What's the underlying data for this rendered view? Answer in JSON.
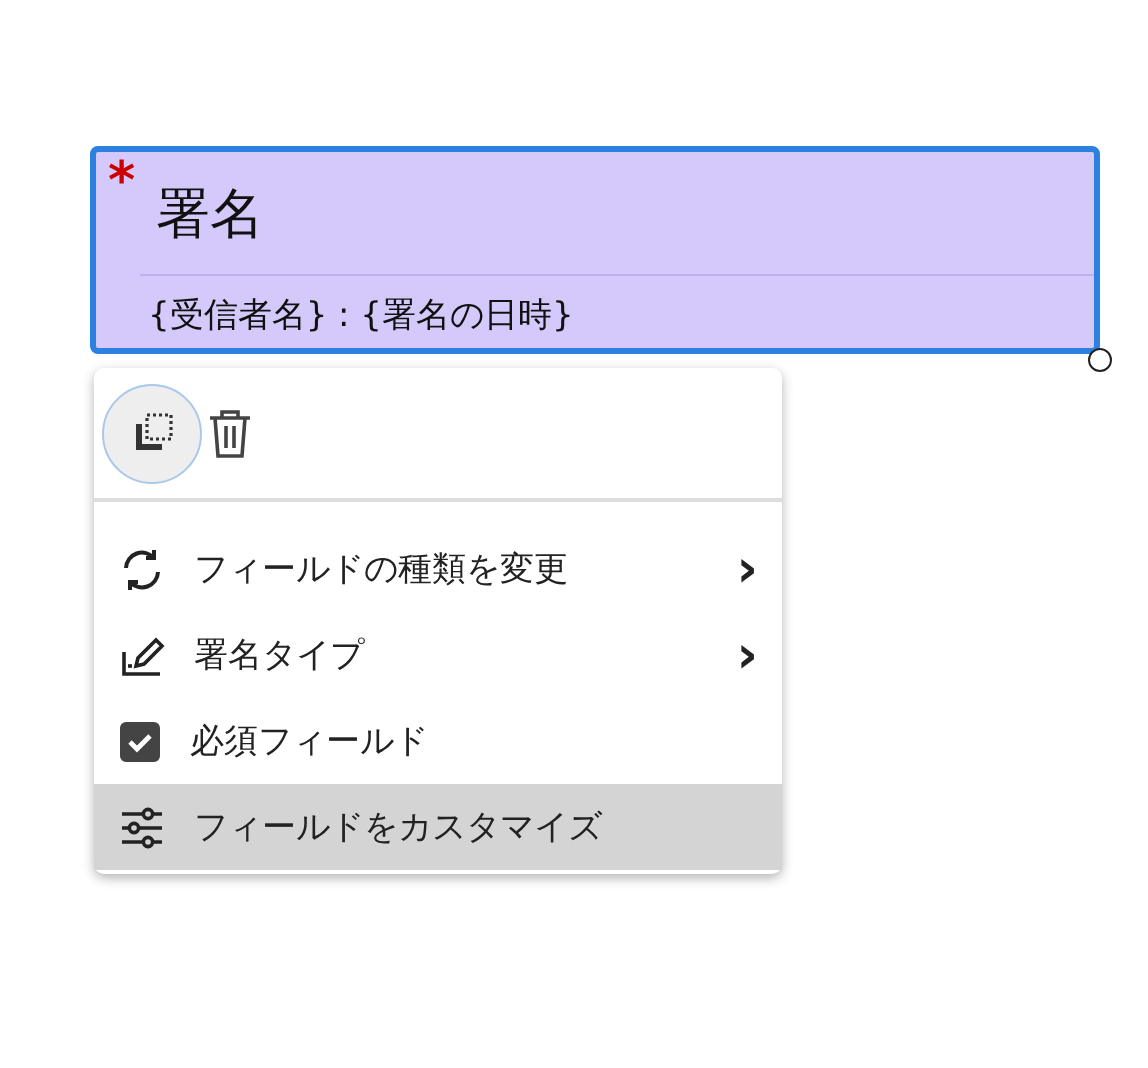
{
  "field": {
    "required_mark": "*",
    "title": "署名",
    "subtitle": "{受信者名} : {署名の日時}",
    "selected": true
  },
  "menu": {
    "items": [
      {
        "kind": "submenu",
        "label": "フィールドの種類を変更",
        "arrow": "›",
        "selected": false
      },
      {
        "kind": "submenu",
        "label": "署名タイプ",
        "arrow": "›",
        "selected": false
      },
      {
        "kind": "checkbox",
        "label": "必須フィールド",
        "checked": true,
        "selected": false
      },
      {
        "kind": "action",
        "label": "フィールドをカスタマイズ",
        "selected": true
      }
    ]
  }
}
